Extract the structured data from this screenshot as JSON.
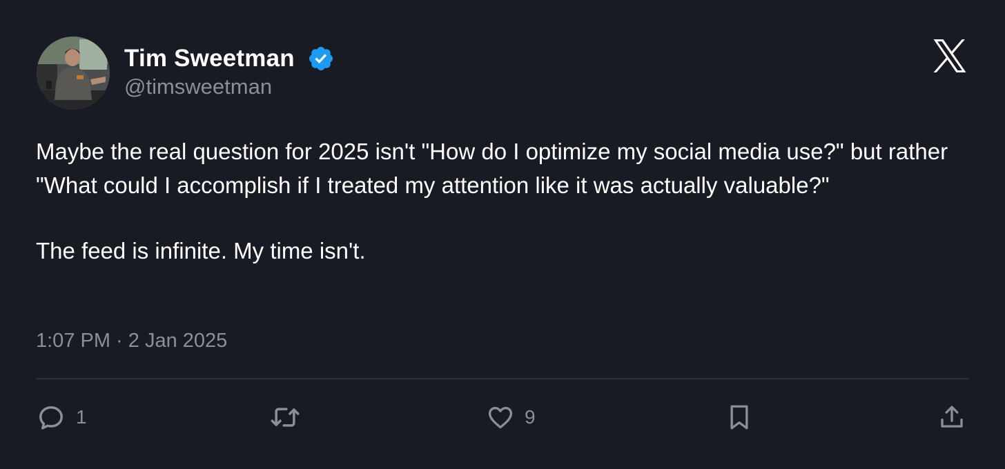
{
  "author": {
    "display_name": "Tim Sweetman",
    "handle": "@timsweetman",
    "verified": true,
    "avatar": "profile-photo"
  },
  "post": {
    "paragraphs": [
      "Maybe the real question for 2025 isn't \"How do I optimize my social media use?\" but rather \"What could I accomplish if I treated my attention like it was actually valuable?\"",
      "The feed is infinite. My time isn't."
    ],
    "timestamp": "1:07 PM · 2 Jan 2025"
  },
  "actions": {
    "reply": {
      "icon": "reply-icon",
      "count": "1"
    },
    "repost": {
      "icon": "repost-icon",
      "count": ""
    },
    "like": {
      "icon": "like-icon",
      "count": "9"
    },
    "bookmark": {
      "icon": "bookmark-icon"
    },
    "share": {
      "icon": "share-icon"
    }
  },
  "brand": {
    "logo": "x-logo-icon"
  },
  "colors": {
    "background": "#191b24",
    "text": "#ffffff",
    "muted": "#8b8f98",
    "verified": "#1d9bf0",
    "divider": "#2e3039"
  }
}
